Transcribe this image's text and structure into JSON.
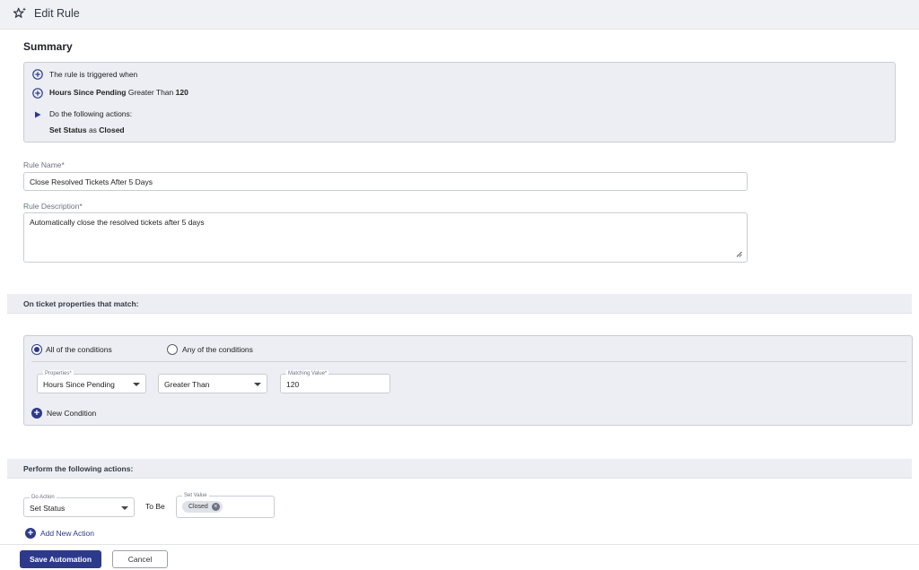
{
  "header": {
    "title": "Edit Rule",
    "icon": "star-icon"
  },
  "summary": {
    "heading": "Summary",
    "triggered_when": "The rule is triggered when",
    "condition": {
      "property": "Hours Since Pending",
      "operator": " Greater Than ",
      "value": "120"
    },
    "do_actions": "Do the following actions:",
    "action": {
      "property": "Set Status",
      "joiner": " as ",
      "value": "Closed"
    }
  },
  "rule_name": {
    "label": "Rule Name*",
    "value": "Close Resolved Tickets After 5 Days"
  },
  "rule_description": {
    "label": "Rule Description*",
    "value": "Automatically close the resolved tickets after 5 days"
  },
  "conditions_section": {
    "heading": "On ticket properties that match:",
    "match_all_label": "All of the conditions",
    "match_any_label": "Any of the conditions",
    "selected": "all",
    "properties_label": "Properties*",
    "properties_value": "Hours Since Pending",
    "operator_value": "Greater Than",
    "matching_label": "Matching Value*",
    "matching_value": "120",
    "new_condition_label": "New Condition"
  },
  "actions_section": {
    "heading": "Perform the following actions:",
    "do_action_label": "Do Action",
    "do_action_value": "Set Status",
    "to_be_label": "To Be",
    "set_value_label": "Set Value",
    "set_value_chip": "Closed",
    "add_action_label": "Add New Action"
  },
  "footer": {
    "save_label": "Save Automation",
    "cancel_label": "Cancel"
  },
  "colors": {
    "primary": "#2d3a8c",
    "panel_bg": "#eceef3",
    "header_bg": "#f0f1f4"
  }
}
